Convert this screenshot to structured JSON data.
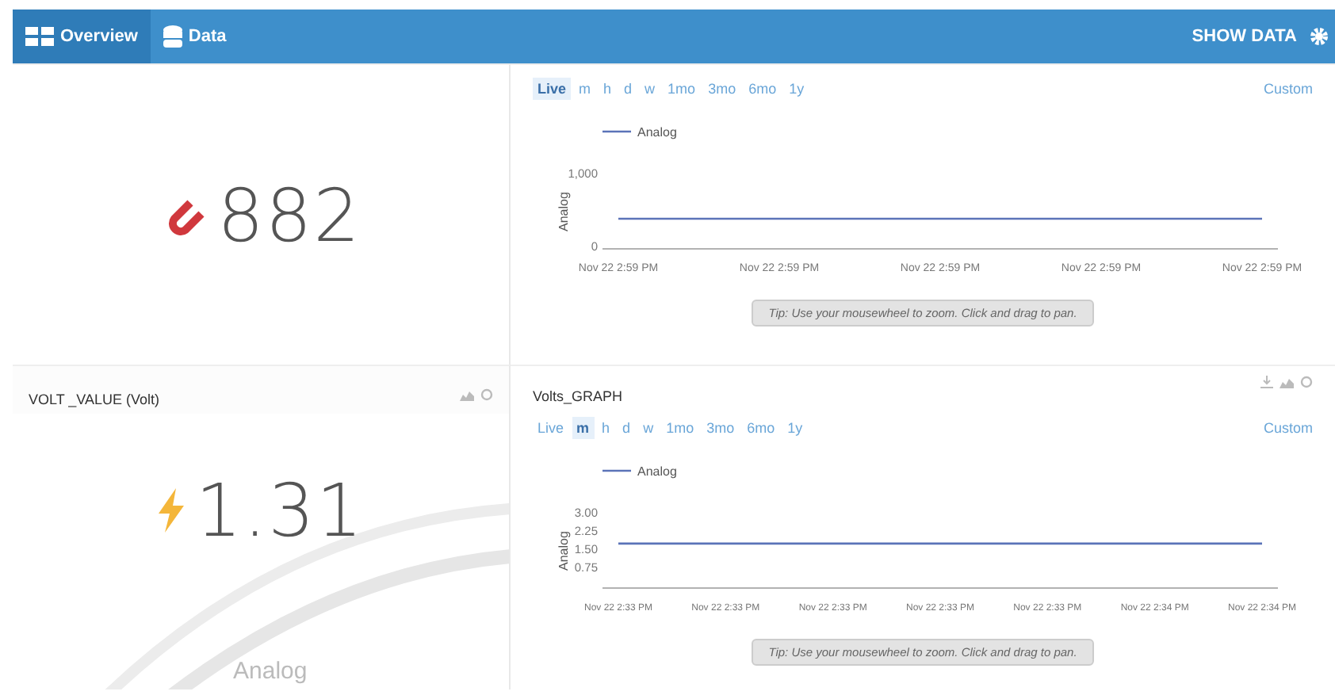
{
  "topbar": {
    "tabs": [
      {
        "label": "Overview",
        "selected": true
      },
      {
        "label": "Data",
        "selected": false
      }
    ],
    "action": "SHOW DATA"
  },
  "widgets": [
    {
      "kind": "metric",
      "value": "882"
    },
    {
      "kind": "chart",
      "ranges": [
        {
          "label": "Live",
          "selected": true
        },
        {
          "label": "m",
          "selected": false
        },
        {
          "label": "h",
          "selected": false
        },
        {
          "label": "d",
          "selected": false
        },
        {
          "label": "w",
          "selected": false
        },
        {
          "label": "1mo",
          "selected": false
        },
        {
          "label": "3mo",
          "selected": false
        },
        {
          "label": "6mo",
          "selected": false
        },
        {
          "label": "1y",
          "selected": false
        }
      ],
      "custom": "Custom",
      "tip": "Tip: Use your mousewheel to zoom. Click and drag to pan.",
      "chart_data": {
        "type": "line",
        "ylabel": "Analog",
        "categories": [
          "Nov 22 2:59 PM",
          "Nov 22 2:59 PM",
          "Nov 22 2:59 PM",
          "Nov 22 2:59 PM",
          "Nov 22 2:59 PM"
        ],
        "series": [
          {
            "name": "Analog",
            "color": "#5b73b8",
            "values": [
              370,
              370,
              370,
              370,
              370
            ]
          }
        ],
        "ylim": [
          0,
          1000
        ],
        "yticks": [
          {
            "value": 1000,
            "label": "1,000"
          },
          {
            "value": 0,
            "label": "0"
          }
        ]
      }
    },
    {
      "kind": "metric",
      "title": "VOLT _VALUE (Volt)",
      "value": "1.31",
      "gauge_label": "Analog"
    },
    {
      "kind": "chart",
      "title": "Volts_GRAPH",
      "ranges": [
        {
          "label": "Live",
          "selected": false
        },
        {
          "label": "m",
          "selected": true
        },
        {
          "label": "h",
          "selected": false
        },
        {
          "label": "d",
          "selected": false
        },
        {
          "label": "w",
          "selected": false
        },
        {
          "label": "1mo",
          "selected": false
        },
        {
          "label": "3mo",
          "selected": false
        },
        {
          "label": "6mo",
          "selected": false
        },
        {
          "label": "1y",
          "selected": false
        }
      ],
      "custom": "Custom",
      "tip": "Tip: Use your mousewheel to zoom. Click and drag to pan.",
      "chart_data": {
        "type": "line",
        "ylabel": "Analog",
        "categories": [
          "Nov 22 2:33 PM",
          "Nov 22 2:33 PM",
          "Nov 22 2:33 PM",
          "Nov 22 2:33 PM",
          "Nov 22 2:33 PM",
          "Nov 22 2:34 PM",
          "Nov 22 2:34 PM"
        ],
        "series": [
          {
            "name": "Analog",
            "color": "#5b73b8",
            "values": [
              1.7,
              1.7,
              1.7,
              1.7,
              1.7,
              1.7,
              1.7
            ]
          }
        ],
        "ylim": [
          0,
          3
        ],
        "yticks": [
          {
            "value": 3,
            "label": "3.00"
          },
          {
            "value": 2.25,
            "label": "2.25"
          },
          {
            "value": 1.5,
            "label": "1.50"
          },
          {
            "value": 0.75,
            "label": "0.75"
          }
        ]
      }
    }
  ]
}
